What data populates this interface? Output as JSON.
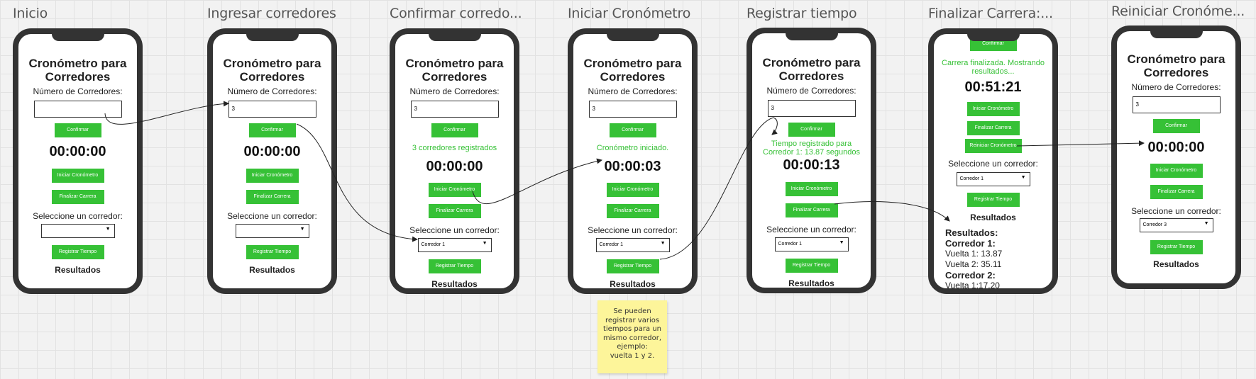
{
  "frames": [
    {
      "title": "Inicio"
    },
    {
      "title": "Ingresar corredores"
    },
    {
      "title": "Confirmar corredo..."
    },
    {
      "title": "Iniciar Cronómetro"
    },
    {
      "title": "Registrar tiempo"
    },
    {
      "title": "Finalizar Carrera:..."
    },
    {
      "title": "Reiniciar Cronóme..."
    }
  ],
  "app": {
    "title_line1": "Cronómetro para",
    "title_line2": "Corredores",
    "num_label": "Número de Corredores:",
    "confirm_label": "Confirmar",
    "start_label": "Iniciar Cronómetro",
    "finish_label": "Finalizar Carrera",
    "select_label": "Seleccione un corredor:",
    "record_label": "Registrar Tiempo",
    "results_label": "Resultados",
    "restart_label": "Reiniciar Cronómetro"
  },
  "screens": {
    "inicio": {
      "input": "",
      "timer": "00:00:00",
      "selected": ""
    },
    "ingresar": {
      "input": "3",
      "timer": "00:00:00",
      "selected": ""
    },
    "confirmar": {
      "input": "3",
      "message": "3 corredores registrados",
      "timer": "00:00:00",
      "selected": "Corredor 1"
    },
    "iniciar": {
      "input": "3",
      "message": "Cronómetro iniciado.",
      "timer": "00:00:03",
      "selected": "Corredor 1"
    },
    "registrar": {
      "input": "3",
      "message_line1": "Tiempo registrado para",
      "message_line2": "Corredor 1: 13.87 segundos",
      "timer": "00:00:13",
      "selected": "Corredor 1"
    },
    "finalizar": {
      "message_line1": "Carrera finalizada. Mostrando",
      "message_line2": "resultados...",
      "timer": "00:51:21",
      "selected": "Corredor 1",
      "results": {
        "heading": "Resultados:",
        "runner1": "Corredor 1:",
        "lap1": "Vuelta 1: 13.87",
        "lap2": "Vuelta 2: 35.11",
        "runner2": "Corredor 2:",
        "lap3": "Vuelta 1:17.20"
      }
    },
    "reiniciar": {
      "input": "3",
      "timer": "00:00:00",
      "selected": "Corredor 3"
    }
  },
  "sticky_note": {
    "lines": [
      "Se pueden",
      "registrar varios",
      "tiempos para un",
      "mismo corredor,",
      "ejemplo:",
      "vuelta 1 y 2."
    ]
  },
  "colors": {
    "accent_green": "#36c136",
    "phone_frame": "#333333",
    "sticky": "#fdf59a",
    "canvas": "#f2f2f2"
  }
}
